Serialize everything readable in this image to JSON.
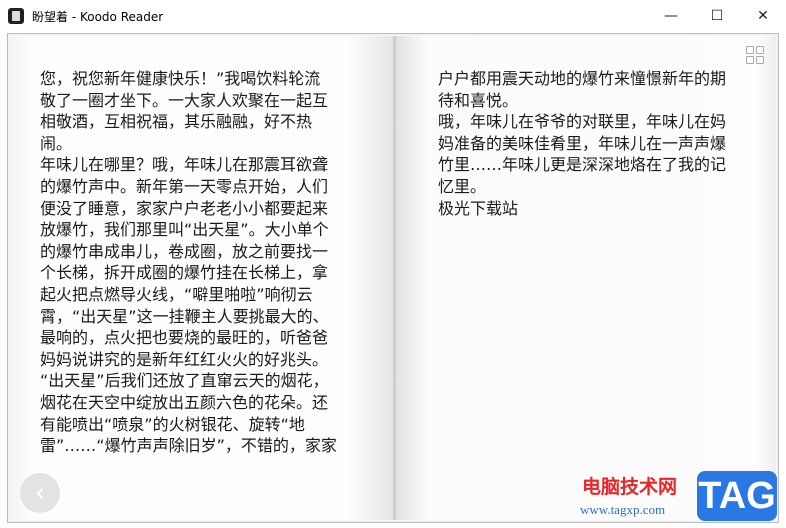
{
  "window": {
    "title": "盼望着 - Koodo Reader",
    "minimize": "—",
    "maximize": "☐",
    "close": "✕"
  },
  "left_page": {
    "lines": [
      "您，祝您新年健康快乐！”我喝饮料轮流",
      "敬了一圈才坐下。一大家人欢聚在一起互",
      "相敬酒，互相祝福，其乐融融，好不热",
      "闹。",
      "年味儿在哪里？哦，年味儿在那震耳欲聋",
      "的爆竹声中。新年第一天零点开始，人们",
      "便没了睡意，家家户户老老小小都要起来",
      "放爆竹，我们那里叫“出天星”。大小单个",
      "的爆竹串成串儿，卷成圈，放之前要找一",
      "个长梯，拆开成圈的爆竹挂在长梯上，拿",
      "起火把点燃导火线，“噼里啪啦”响彻云",
      "霄，“出天星”这一挂鞭主人要挑最大的、",
      "最响的，点火把也要烧的最旺的，听爸爸",
      "妈妈说讲究的是新年红红火火的好兆头。",
      "“出天星”后我们还放了直窜云天的烟花，",
      "烟花在天空中绽放出五颜六色的花朵。还",
      "有能喷出“喷泉”的火树银花、旋转“地",
      "雷”……“爆竹声声除旧岁”，不错的，家家"
    ]
  },
  "right_page": {
    "lines": [
      "户户都用震天动地的爆竹来憧憬新年的期",
      "待和喜悦。",
      "哦，年味儿在爷爷的对联里，年味儿在妈",
      "妈准备的美味佳肴里，年味儿在一声声爆",
      "竹里……年味儿更是深深地烙在了我的记",
      "忆里。",
      "极光下载站"
    ]
  },
  "controls": {
    "prev_icon": "chevron-left-icon",
    "back_glyph": "‹",
    "menu_icon": "grid-icon"
  },
  "watermark": {
    "site_name": "电脑技术网",
    "url": "www.tagxp.com",
    "badge": "TAG"
  }
}
